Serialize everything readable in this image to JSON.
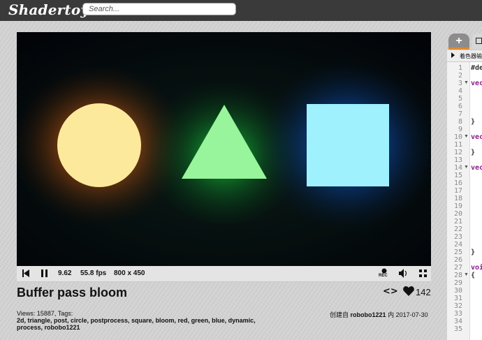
{
  "header": {
    "logo": "Shadertoy",
    "search_placeholder": "Search..."
  },
  "player": {
    "time": "9.62",
    "fps": "55.8 fps",
    "resolution": "800 x 450",
    "rec_label": "REC"
  },
  "shader": {
    "title": "Buffer pass bloom",
    "code_toggle": "<>",
    "likes": "142",
    "views_label": "Views: 15887, Tags:",
    "tags": "2d, triangle, post, circle, postprocess, square, bloom, red, green, blue, dynamic, process, robobo1221",
    "created_prefix": "创建自",
    "author": "robobo1221",
    "created_infix": "内",
    "date": "2017-07-30"
  },
  "editor": {
    "add_tab": "+",
    "header": "着色器输入",
    "lines": [
      {
        "n": "1",
        "code": "#de",
        "cls": "pl"
      },
      {
        "n": "2",
        "code": "",
        "cls": "pl"
      },
      {
        "n": "3",
        "code": "vec",
        "cls": "kw",
        "fold": true
      },
      {
        "n": "4",
        "code": "",
        "cls": "pl"
      },
      {
        "n": "5",
        "code": "",
        "cls": "pl"
      },
      {
        "n": "6",
        "code": "",
        "cls": "pl"
      },
      {
        "n": "7",
        "code": "",
        "cls": "pl"
      },
      {
        "n": "8",
        "code": "}",
        "cls": "pl"
      },
      {
        "n": "9",
        "code": "",
        "cls": "pl"
      },
      {
        "n": "10",
        "code": "vec",
        "cls": "kw",
        "fold": true
      },
      {
        "n": "11",
        "code": "",
        "cls": "pl"
      },
      {
        "n": "12",
        "code": "}",
        "cls": "pl"
      },
      {
        "n": "13",
        "code": "",
        "cls": "pl"
      },
      {
        "n": "14",
        "code": "vec",
        "cls": "kw",
        "fold": true
      },
      {
        "n": "15",
        "code": "",
        "cls": "pl"
      },
      {
        "n": "16",
        "code": "",
        "cls": "pl"
      },
      {
        "n": "17",
        "code": "",
        "cls": "pl"
      },
      {
        "n": "18",
        "code": "",
        "cls": "pl"
      },
      {
        "n": "19",
        "code": "",
        "cls": "pl"
      },
      {
        "n": "20",
        "code": "",
        "cls": "pl"
      },
      {
        "n": "21",
        "code": "",
        "cls": "pl"
      },
      {
        "n": "22",
        "code": "",
        "cls": "pl"
      },
      {
        "n": "23",
        "code": "",
        "cls": "pl"
      },
      {
        "n": "24",
        "code": "",
        "cls": "pl"
      },
      {
        "n": "25",
        "code": "}",
        "cls": "pl"
      },
      {
        "n": "26",
        "code": "",
        "cls": "pl"
      },
      {
        "n": "27",
        "code": "voi",
        "cls": "kw"
      },
      {
        "n": "28",
        "code": "{",
        "cls": "pl",
        "fold": true
      },
      {
        "n": "29",
        "code": "",
        "cls": "pl"
      },
      {
        "n": "30",
        "code": "",
        "cls": "pl"
      },
      {
        "n": "31",
        "code": "",
        "cls": "pl"
      },
      {
        "n": "32",
        "code": "",
        "cls": "pl"
      },
      {
        "n": "33",
        "code": "",
        "cls": "pl"
      },
      {
        "n": "34",
        "code": "",
        "cls": "pl"
      },
      {
        "n": "35",
        "code": "",
        "cls": "pl"
      }
    ]
  },
  "colors": {
    "circle": "#fde99c",
    "circle_glow": "#ff8a1a",
    "triangle": "#98f59b",
    "triangle_glow": "#17d83a",
    "square": "#9ef1fd",
    "square_glow": "#1f7bff",
    "accent": "#e08a2c"
  }
}
